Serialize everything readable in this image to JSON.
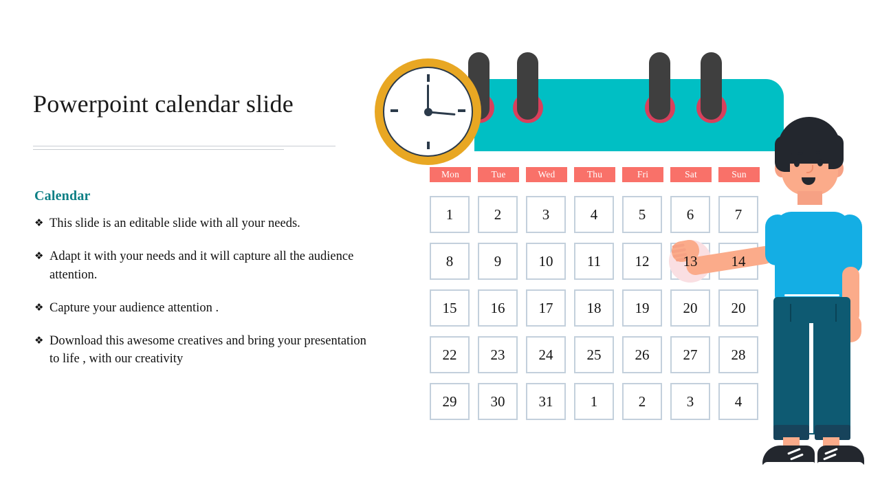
{
  "slide": {
    "title": "Powerpoint calendar slide",
    "section_heading": "Calendar",
    "bullet_glyph": "❖",
    "bullets": [
      "This slide is an editable slide with all your needs.",
      "Adapt it with your needs and it will capture all the audience attention.",
      "Capture your audience attention .",
      "Download this awesome creatives and bring your presentation to life , with our creativity"
    ]
  },
  "calendar": {
    "day_headers": [
      "Mon",
      "Tue",
      "Wed",
      "Thu",
      "Fri",
      "Sat",
      "Sun"
    ],
    "weeks": [
      [
        "1",
        "2",
        "3",
        "4",
        "5",
        "6",
        "7"
      ],
      [
        "8",
        "9",
        "10",
        "11",
        "12",
        "13",
        "14"
      ],
      [
        "15",
        "16",
        "17",
        "18",
        "19",
        "20",
        "20"
      ],
      [
        "22",
        "23",
        "24",
        "25",
        "26",
        "27",
        "28"
      ],
      [
        "29",
        "30",
        "31",
        "1",
        "2",
        "3",
        "4"
      ]
    ],
    "selected_date": "13",
    "clock": {
      "hour_hand": "3",
      "minute_hand": "12",
      "tick_positions": [
        "12",
        "3",
        "6",
        "9"
      ]
    },
    "binder_ring_count": 4
  },
  "colors": {
    "teal_header": "#00bfc4",
    "day_header_coral": "#f97169",
    "cell_border": "#c3d0dc",
    "selected_highlight": "#fadfe2",
    "section_heading_teal": "#0d7f85",
    "clock_ring_gold": "#e8a723",
    "binder_ring_red": "#d8405c",
    "binder_post_gray": "#3f3f3f",
    "shirt_blue": "#14aee4",
    "pants_teal": "#0e5a72",
    "skin": "#fbab8a",
    "hair_dark": "#23272e",
    "title_text": "#1a1a1a"
  }
}
